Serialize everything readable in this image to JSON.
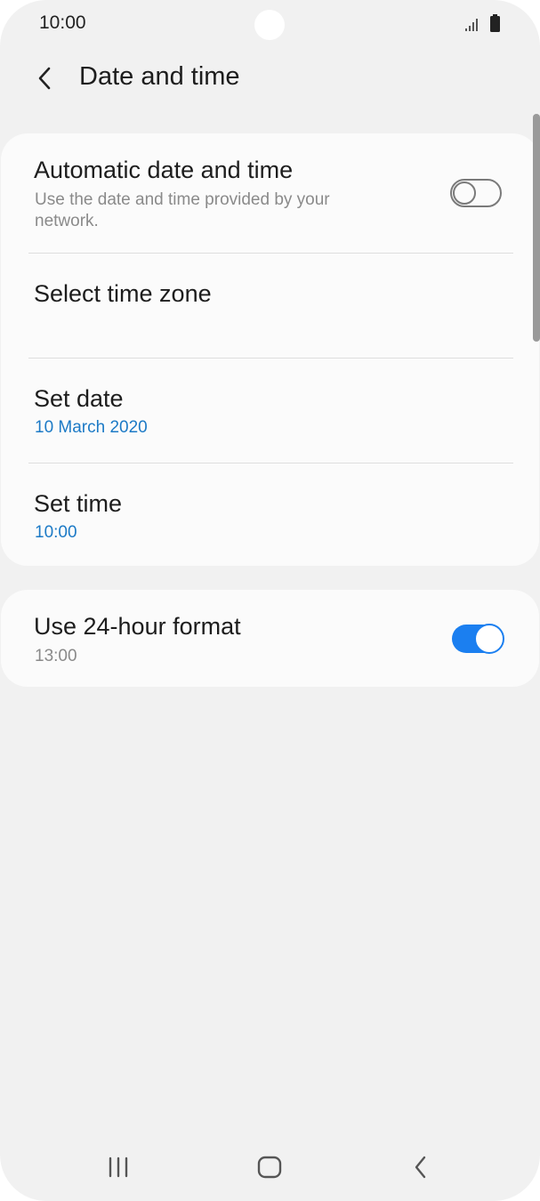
{
  "status_bar": {
    "time": "10:00",
    "icons": [
      "signal-icon",
      "battery-icon"
    ]
  },
  "app_bar": {
    "back_icon": "chevron-left-icon",
    "title": "Date and time"
  },
  "settings": {
    "automatic_date_time": {
      "title": "Automatic date and time",
      "description_line1": "Use the date and time provided by your",
      "description_line2": "network.",
      "enabled": false
    },
    "select_time_zone": {
      "title": "Select time zone"
    },
    "set_date": {
      "title": "Set date",
      "value": "10 March 2020"
    },
    "set_time": {
      "title": "Set time",
      "value": "10:00"
    },
    "use_24_hour_format": {
      "title": "Use 24-hour format",
      "example": "13:00",
      "enabled": true
    }
  },
  "nav_bar": {
    "buttons": [
      "recents-icon",
      "home-icon",
      "back-icon"
    ]
  },
  "colors": {
    "background": "#f1f1f1",
    "card": "#fbfbfb",
    "accent_blue": "#1b7ff0",
    "value_blue": "#1c7ac6",
    "secondary_text": "#8a8a8a",
    "primary_text": "#1d1d1d"
  }
}
